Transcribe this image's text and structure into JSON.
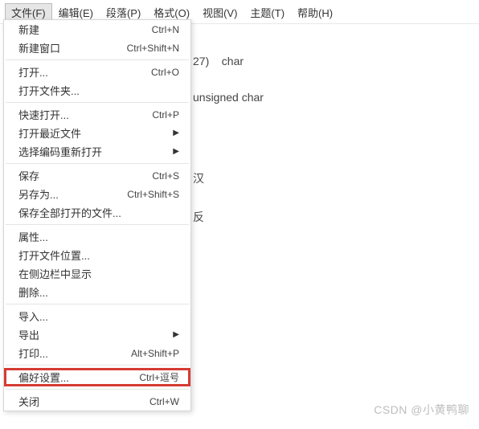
{
  "menubar": [
    {
      "label": "文件(F)",
      "active": true
    },
    {
      "label": "编辑(E)"
    },
    {
      "label": "段落(P)"
    },
    {
      "label": "格式(O)"
    },
    {
      "label": "视图(V)"
    },
    {
      "label": "主题(T)"
    },
    {
      "label": "帮助(H)"
    }
  ],
  "dropdown": {
    "groups": [
      [
        {
          "label": "新建",
          "shortcut": "Ctrl+N"
        },
        {
          "label": "新建窗口",
          "shortcut": "Ctrl+Shift+N"
        }
      ],
      [
        {
          "label": "打开...",
          "shortcut": "Ctrl+O"
        },
        {
          "label": "打开文件夹..."
        }
      ],
      [
        {
          "label": "快速打开...",
          "shortcut": "Ctrl+P"
        },
        {
          "label": "打开最近文件",
          "submenu": true
        },
        {
          "label": "选择编码重新打开",
          "submenu": true
        }
      ],
      [
        {
          "label": "保存",
          "shortcut": "Ctrl+S"
        },
        {
          "label": "另存为...",
          "shortcut": "Ctrl+Shift+S"
        },
        {
          "label": "保存全部打开的文件..."
        }
      ],
      [
        {
          "label": "属性..."
        },
        {
          "label": "打开文件位置..."
        },
        {
          "label": "在侧边栏中显示"
        },
        {
          "label": "删除..."
        }
      ],
      [
        {
          "label": "导入..."
        },
        {
          "label": "导出",
          "submenu": true
        },
        {
          "label": "打印...",
          "shortcut": "Alt+Shift+P"
        }
      ],
      [
        {
          "label": "偏好设置...",
          "shortcut": "Ctrl+逗号",
          "highlight": true
        }
      ],
      [
        {
          "label": "关闭",
          "shortcut": "Ctrl+W"
        }
      ]
    ]
  },
  "document": {
    "line1_left": "27)",
    "line1_right": "char",
    "line2": "unsigned char",
    "line3": "汉",
    "line4": "反"
  },
  "watermark": "CSDN @小黄鸭聊"
}
